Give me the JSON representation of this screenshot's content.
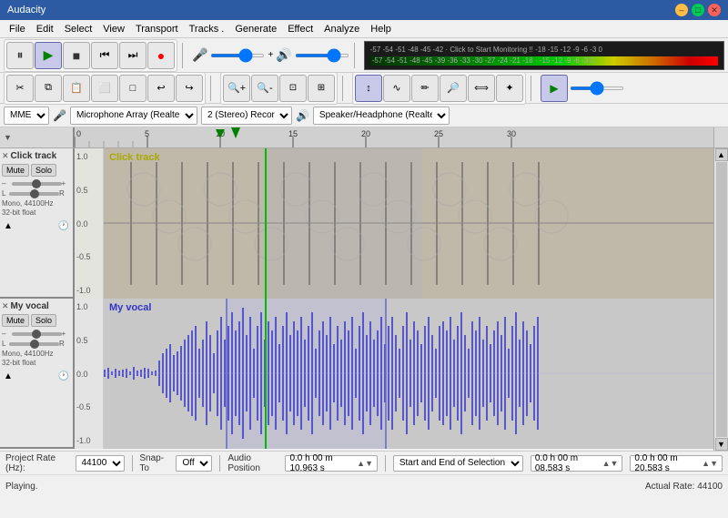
{
  "app": {
    "title": "Audacity"
  },
  "titlebar": {
    "title": "Audacity"
  },
  "menubar": {
    "items": [
      "File",
      "Edit",
      "Select",
      "View",
      "Transport",
      "Tracks .",
      "Generate",
      "Effect",
      "Analyze",
      "Help"
    ]
  },
  "toolbar": {
    "pause_label": "⏸",
    "play_label": "▶",
    "stop_label": "■",
    "rewind_label": "⏮",
    "forward_label": "⏭",
    "record_label": "●"
  },
  "device_bar": {
    "api": "MME",
    "mic_icon": "🎤",
    "mic_device": "Microphone Array (Realtek",
    "rec_channels": "2 (Stereo) Recor",
    "spk_icon": "🔊",
    "spk_device": "Speaker/Headphone (Realte"
  },
  "ruler": {
    "markers": [
      "0",
      "5",
      "10",
      "15",
      "20",
      "25",
      "30"
    ]
  },
  "tracks": [
    {
      "id": "click-track",
      "name": "Click track",
      "label": "Click track",
      "mute": "Mute",
      "solo": "Solo",
      "info": "Mono, 44100Hz\n32-bit float",
      "height": 165
    },
    {
      "id": "vocal-track",
      "name": "My vocal",
      "label": "My vocal",
      "mute": "Mute",
      "solo": "Solo",
      "info": "Mono, 44100Hz\n32-bit float",
      "height": 165
    }
  ],
  "bottom": {
    "project_rate_label": "Project Rate (Hz):",
    "project_rate": "44100",
    "snap_label": "Snap-To",
    "snap_value": "Off",
    "audio_pos_label": "Audio Position",
    "audio_pos": "0 h 00 m 10.963 s",
    "selection_label": "Start and End of Selection",
    "sel_start": "0 h 00 m 08.583 s",
    "sel_end": "0 h 00 m 20.583 s",
    "status": "Playing.",
    "actual_rate": "Actual Rate: 44100"
  }
}
